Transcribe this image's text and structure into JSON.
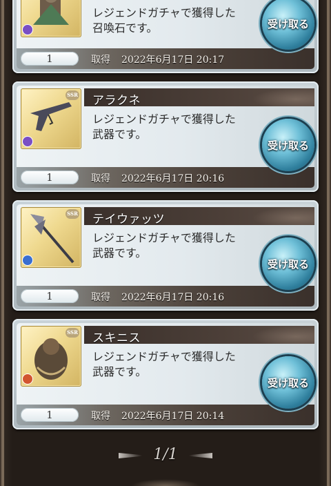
{
  "items": [
    {
      "name": "",
      "description": "レジェンドガチャで獲得した召喚石です。",
      "count": "1",
      "acquired_label": "取得",
      "acquired_at": "2022年6月17日 20:17",
      "receive_label": "受け取る",
      "icon": "summon-stone-icon",
      "element_color": "#7a4fc4"
    },
    {
      "name": "アラクネ",
      "description": "レジェンドガチャで獲得した武器です。",
      "count": "1",
      "acquired_label": "取得",
      "acquired_at": "2022年6月17日 20:16",
      "receive_label": "受け取る",
      "icon": "gun-icon",
      "rarity": "SSR",
      "element_color": "#7a4fc4"
    },
    {
      "name": "テイウァッツ",
      "description": "レジェンドガチャで獲得した武器です。",
      "count": "1",
      "acquired_label": "取得",
      "acquired_at": "2022年6月17日 20:16",
      "receive_label": "受け取る",
      "icon": "halberd-icon",
      "rarity": "SSR",
      "element_color": "#3a6fd0"
    },
    {
      "name": "スキニス",
      "description": "レジェンドガチャで獲得した武器です。",
      "count": "1",
      "acquired_label": "取得",
      "acquired_at": "2022年6月17日 20:14",
      "receive_label": "受け取る",
      "icon": "idol-icon",
      "rarity": "SSR",
      "element_color": "#d2552f"
    }
  ],
  "pager": {
    "label": "1/1"
  }
}
